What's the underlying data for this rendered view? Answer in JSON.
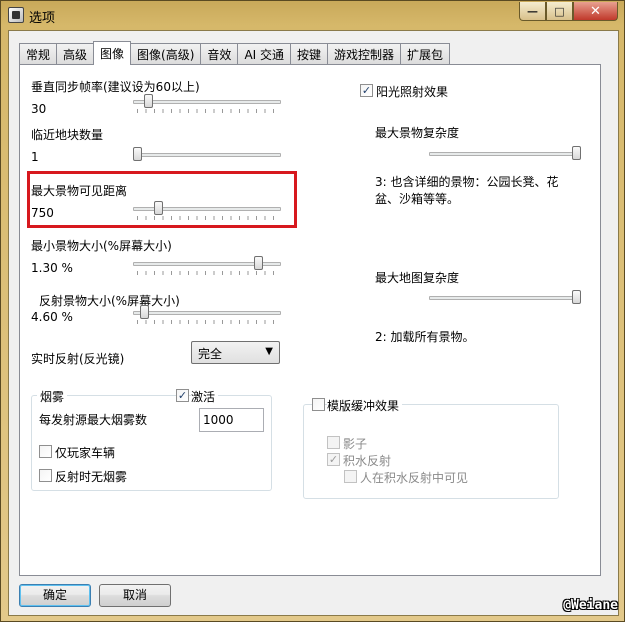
{
  "window": {
    "title": "选项",
    "minimize_glyph": "—",
    "maximize_glyph": "□",
    "close_glyph": "✕"
  },
  "tabs": [
    {
      "label": "常规"
    },
    {
      "label": "高级"
    },
    {
      "label": "图像",
      "active": true
    },
    {
      "label": "图像(高级)"
    },
    {
      "label": "音效"
    },
    {
      "label": "AI 交通"
    },
    {
      "label": "按键"
    },
    {
      "label": "游戏控制器"
    },
    {
      "label": "扩展包"
    }
  ],
  "left": {
    "vsync": {
      "label": "垂直同步帧率(建议设为60以上)",
      "value": "30",
      "fraction": 0.08
    },
    "tiles": {
      "label": "临近地块数量",
      "value": "1",
      "fraction": 0.0
    },
    "view_distance": {
      "label": "最大景物可见距离",
      "value": "750",
      "fraction": 0.15
    },
    "min_size": {
      "label": "最小景物大小(%屏幕大小)",
      "value": "1.30 %",
      "fraction": 0.87
    },
    "reflect_size": {
      "label": "反射景物大小(%屏幕大小)",
      "value": "4.60 %",
      "fraction": 0.05
    },
    "realtime_reflection": {
      "label": "实时反射(反光镜)",
      "selected": "完全",
      "arrow": "▼"
    }
  },
  "fog": {
    "title": "烟雾",
    "activate": {
      "label": "激活",
      "checked": true,
      "mark": "✓"
    },
    "max_fog": {
      "label": "每发射源最大烟雾数",
      "value": "1000"
    },
    "player_only": {
      "label": "仅玩家车辆",
      "checked": false
    },
    "no_fog_reflection": {
      "label": "反射时无烟雾",
      "checked": false
    }
  },
  "right": {
    "sunlight": {
      "label": "阳光照射效果",
      "checked": true,
      "mark": "✓"
    },
    "scenery_complexity": {
      "label": "最大景物复杂度",
      "fraction": 1.0,
      "desc": "3: 也含详细的景物：公园长凳、花盆、沙箱等等。"
    },
    "terrain_complexity": {
      "label": "最大地图复杂度",
      "fraction": 1.0,
      "desc": "2: 加载所有景物。"
    }
  },
  "stencil": {
    "title": "模版缓冲效果",
    "checked": false,
    "shadow": {
      "label": "影子",
      "checked": false
    },
    "water_reflection": {
      "label": "积水反射",
      "checked": true,
      "mark": "✓"
    },
    "person_in_reflection": {
      "label": "人在积水反射中可见",
      "checked": false
    }
  },
  "buttons": {
    "ok": "确定",
    "cancel": "取消"
  },
  "watermark": "@Weiane",
  "colors": {
    "highlight": "#d7181e",
    "accent_focus": "#3c7fb1"
  }
}
